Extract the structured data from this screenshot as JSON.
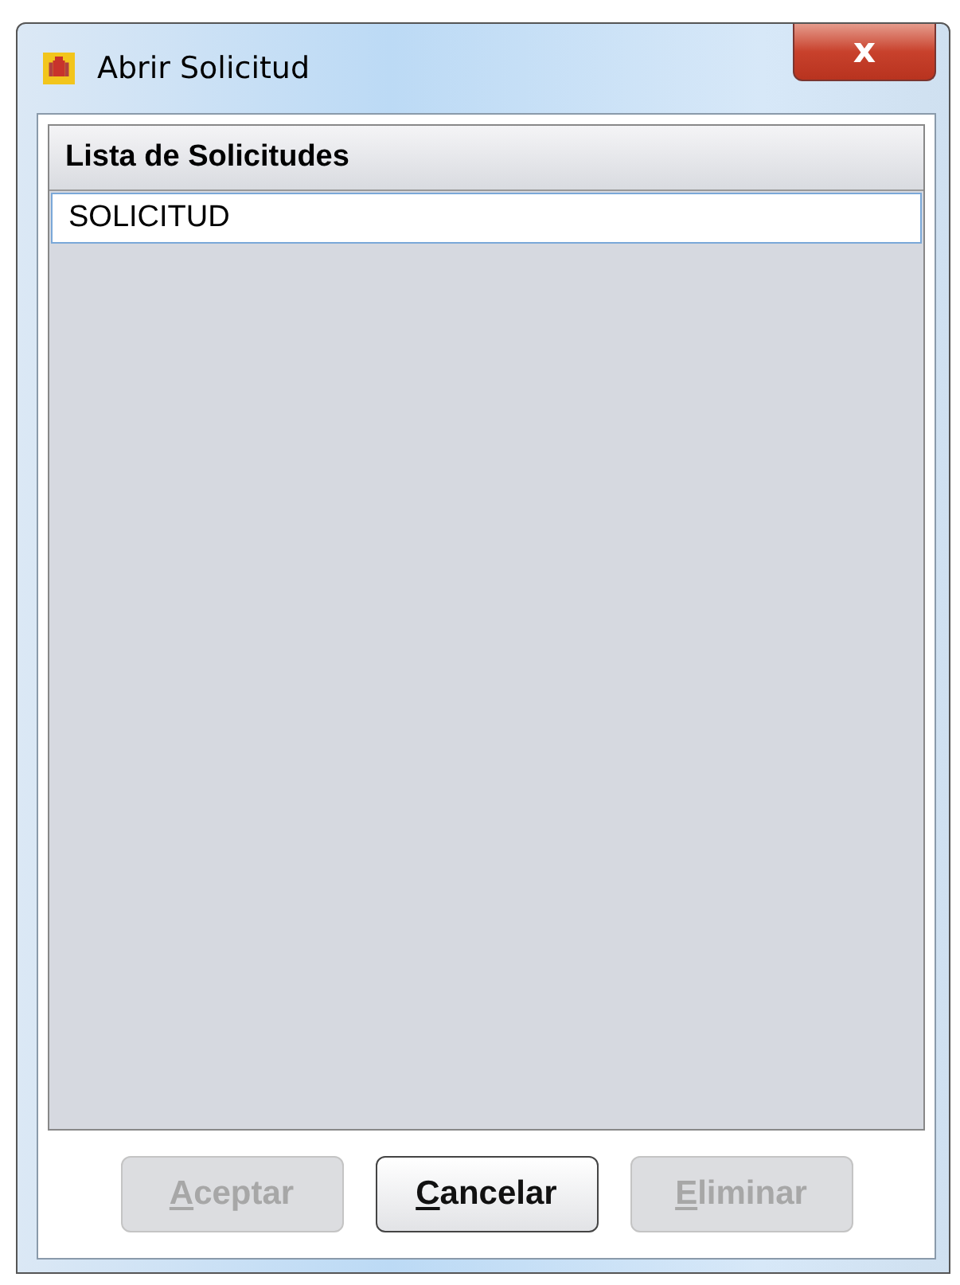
{
  "window": {
    "title": "Abrir Solicitud",
    "close": "x"
  },
  "list": {
    "header": "Lista de Solicitudes",
    "items": [
      {
        "label": "SOLICITUD",
        "selected": true
      }
    ]
  },
  "buttons": [
    {
      "label": "Aceptar",
      "disabled": true,
      "mnemonic_underlined": true
    },
    {
      "label": "Cancelar",
      "disabled": false,
      "mnemonic_underlined": true
    },
    {
      "label": "Eliminar",
      "disabled": true,
      "mnemonic_underlined": true
    }
  ]
}
